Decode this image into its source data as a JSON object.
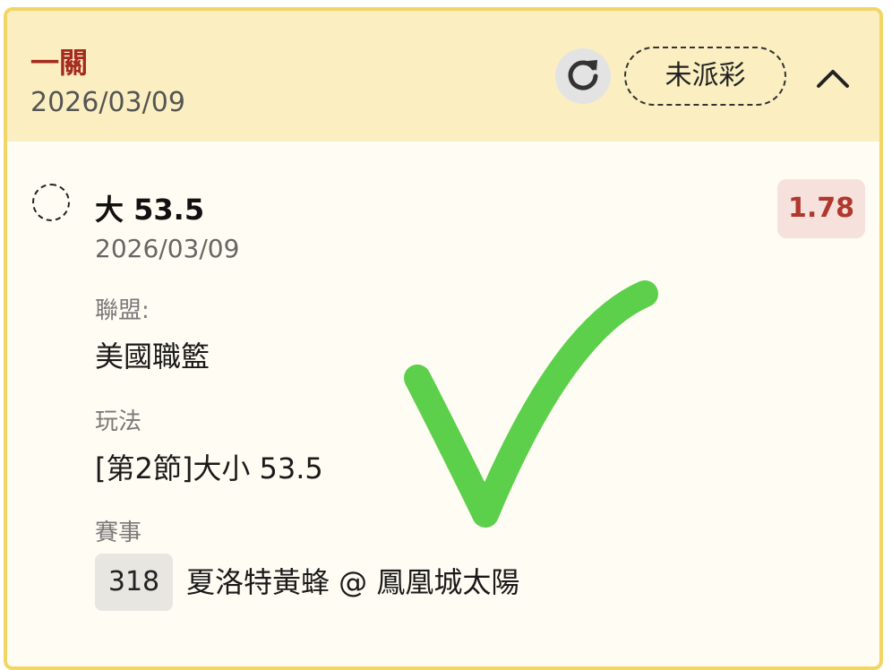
{
  "header": {
    "title": "一關",
    "date": "2026/03/09",
    "status_label": "未派彩"
  },
  "bet": {
    "name": "大 53.5",
    "date": "2026/03/09",
    "odds": "1.78"
  },
  "details": {
    "league_label": "聯盟:",
    "league_value": "美國職籃",
    "play_label": "玩法",
    "play_value": "[第2節]大小 53.5",
    "event_label": "賽事",
    "event_id": "318",
    "event_name": "夏洛特黃蜂 @ 鳳凰城太陽"
  },
  "colors": {
    "accent_title": "#a52a1d",
    "card_border": "#f3d565",
    "header_bg": "#fbefc1",
    "odds_text": "#b0382c",
    "check_mark": "#5ccf4b"
  },
  "icons": {
    "refresh": "refresh-icon",
    "collapse": "chevron-up-icon",
    "selection": "radio-circle-icon",
    "result": "checkmark-icon"
  }
}
